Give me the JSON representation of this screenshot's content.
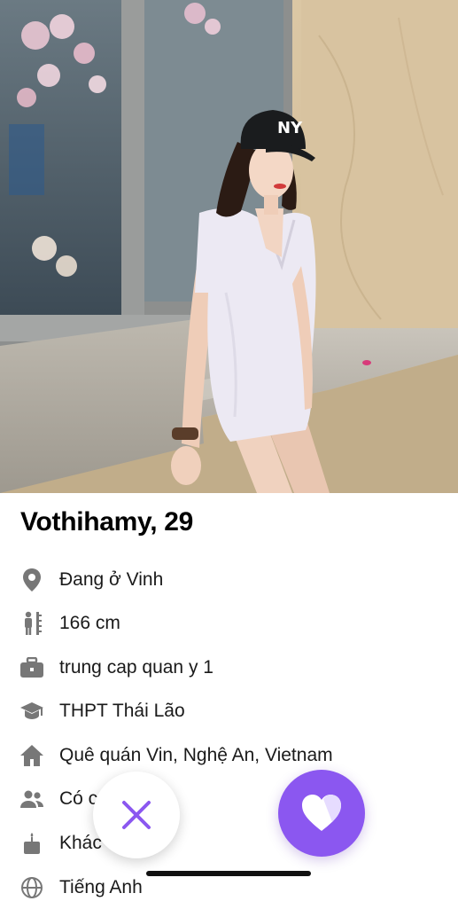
{
  "profile": {
    "name_age": "Vothihamy, 29"
  },
  "details": [
    {
      "icon": "location-pin-icon",
      "text": "Đang ở Vinh"
    },
    {
      "icon": "height-ruler-icon",
      "text": "166 cm"
    },
    {
      "icon": "briefcase-icon",
      "text": "trung cap quan y 1"
    },
    {
      "icon": "graduation-cap-icon",
      "text": "THPT Thái Lão"
    },
    {
      "icon": "home-icon",
      "text": "Quê quán Vin, Nghệ An, Vietnam"
    },
    {
      "icon": "people-icon",
      "text": "Có c"
    },
    {
      "icon": "cake-icon",
      "text": "Khác"
    },
    {
      "icon": "globe-icon",
      "text": "Tiếng Anh"
    }
  ],
  "actions": {
    "dislike_icon": "close-x-icon",
    "like_icon": "heart-icon"
  },
  "colors": {
    "accent": "#8b57f0",
    "icon_gray": "#777777"
  }
}
